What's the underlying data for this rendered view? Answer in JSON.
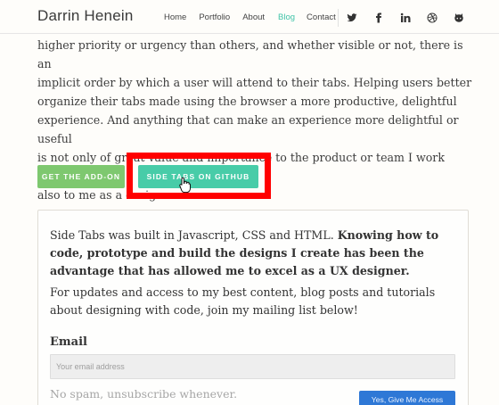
{
  "header": {
    "brand": "Darrin Henein",
    "nav": {
      "home": "Home",
      "portfolio": "Portfolio",
      "about": "About",
      "blog": "Blog",
      "contact": "Contact"
    },
    "social_icons": [
      "twitter-icon",
      "facebook-icon",
      "linkedin-icon",
      "dribbble-icon",
      "github-icon"
    ]
  },
  "article": {
    "paragraph_lines": [
      "higher priority or urgency than others, and whether visible or not, there is an",
      "implicit order by which a user will attend to their tabs. Helping users better",
      "organize their tabs made using the browser a more productive, delightful",
      "experience. And anything that can make an experience more delightful or useful",
      "is not only of great value and importance to the product or team I work with, but",
      "also to me as a designer."
    ],
    "paragraph_text": "higher priority or urgency than others, and whether visible or not, there is an\nimplicit order by which a user will attend to their tabs. Helping users better\norganize their tabs made using the browser a more productive, delightful\nexperience. And anything that can make an experience more delightful or useful\nis not only of great value and importance to the product or team I work with, but\nalso to me as a designer.",
    "buttons": {
      "get_addon": "GET THE ADD-ON",
      "side_tabs_github": "SIDE TABS ON GITHUB"
    }
  },
  "card": {
    "text_plain": "Side Tabs was built in Javascript, CSS and HTML. ",
    "text_bold": "Knowing how to code, prototype and build the designs I create has been the advantage that has allowed me to excel as a UX designer.",
    "updates_text": "For updates and access to my best content, blog posts and tutorials about designing with code, join my mailing list below!",
    "email_label": "Email",
    "email_placeholder": "Your email address",
    "email_value": "",
    "spam_note": "No spam, unsubscribe whenever.",
    "submit_label": "Yes, Give Me Access"
  },
  "colors": {
    "accent_teal": "#48cca8",
    "addon_green": "#7ec86f",
    "highlight_red": "#ff0000",
    "submit_blue": "#2e78d6"
  }
}
